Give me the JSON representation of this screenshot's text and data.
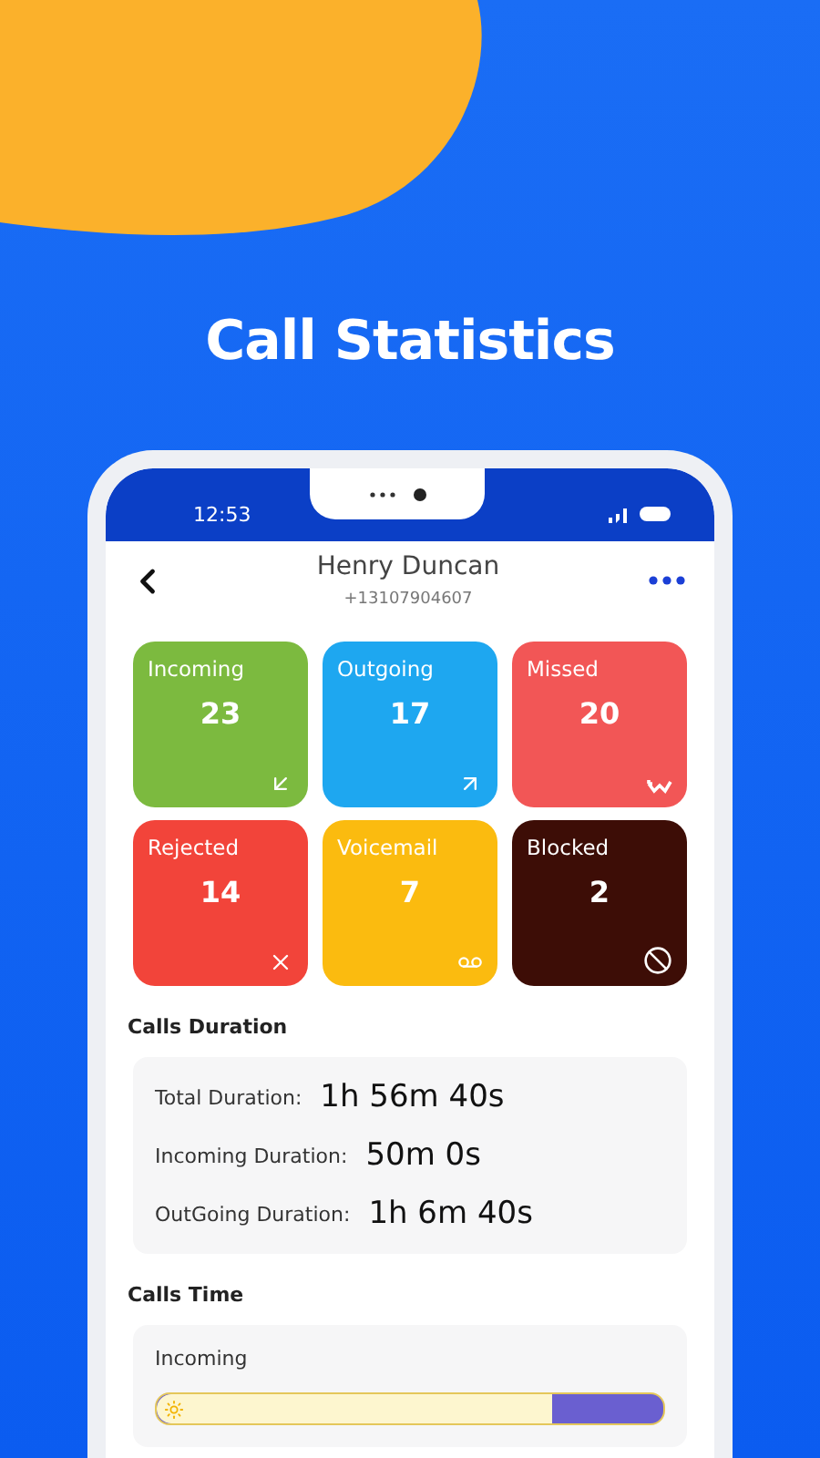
{
  "headline": "Call Statistics",
  "status_bar": {
    "time": "12:53"
  },
  "contact": {
    "name": "Henry Duncan",
    "phone": "+13107904607"
  },
  "tiles": [
    {
      "kind": "incoming",
      "label": "Incoming",
      "count": "23",
      "color": "#7cba3f"
    },
    {
      "kind": "outgoing",
      "label": "Outgoing",
      "count": "17",
      "color": "#1ea7f0"
    },
    {
      "kind": "missed",
      "label": "Missed",
      "count": "20",
      "color": "#f25656"
    },
    {
      "kind": "rejected",
      "label": "Rejected",
      "count": "14",
      "color": "#f2443a"
    },
    {
      "kind": "voicemail",
      "label": "Voicemail",
      "count": "7",
      "color": "#fbbb0f"
    },
    {
      "kind": "blocked",
      "label": "Blocked",
      "count": "2",
      "color": "#3d0d06"
    }
  ],
  "calls_duration": {
    "title": "Calls Duration",
    "rows": [
      {
        "label": "Total Duration:",
        "value": "1h 56m 40s"
      },
      {
        "label": "Incoming Duration:",
        "value": "50m 0s"
      },
      {
        "label": "OutGoing Duration:",
        "value": "1h 6m 40s"
      }
    ]
  },
  "calls_time": {
    "title": "Calls Time",
    "items": [
      {
        "label": "Incoming",
        "level": 0.78
      }
    ]
  }
}
